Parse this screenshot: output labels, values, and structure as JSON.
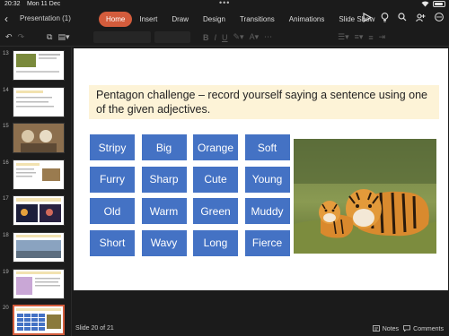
{
  "status": {
    "time": "20:32",
    "date": "Mon 11 Dec",
    "more": "•••"
  },
  "header": {
    "document_title": "Presentation (1)",
    "tabs": [
      {
        "label": "Home",
        "active": true
      },
      {
        "label": "Insert",
        "active": false
      },
      {
        "label": "Draw",
        "active": false
      },
      {
        "label": "Design",
        "active": false
      },
      {
        "label": "Transitions",
        "active": false
      },
      {
        "label": "Animations",
        "active": false
      },
      {
        "label": "Slide Show",
        "active": false
      }
    ]
  },
  "sidebar": {
    "thumbnails": [
      {
        "number": "13"
      },
      {
        "number": "14"
      },
      {
        "number": "15"
      },
      {
        "number": "16"
      },
      {
        "number": "17"
      },
      {
        "number": "18"
      },
      {
        "number": "19"
      },
      {
        "number": "20"
      }
    ]
  },
  "slide": {
    "title": "Pentagon challenge – record yourself saying a sentence using one of the given adjectives.",
    "adjectives": [
      "Stripy",
      "Big",
      "Orange",
      "Soft",
      "Furry",
      "Sharp",
      "Cute",
      "Young",
      "Old",
      "Warm",
      "Green",
      "Muddy",
      "Short",
      "Wavy",
      "Long",
      "Fierce"
    ]
  },
  "footer": {
    "slide_counter": "Slide 20 of 21",
    "notes_label": "Notes",
    "comments_label": "Comments"
  },
  "colors": {
    "accent": "#d35c3c",
    "word_box": "#4472c4",
    "title_band": "#fdf3d7"
  }
}
